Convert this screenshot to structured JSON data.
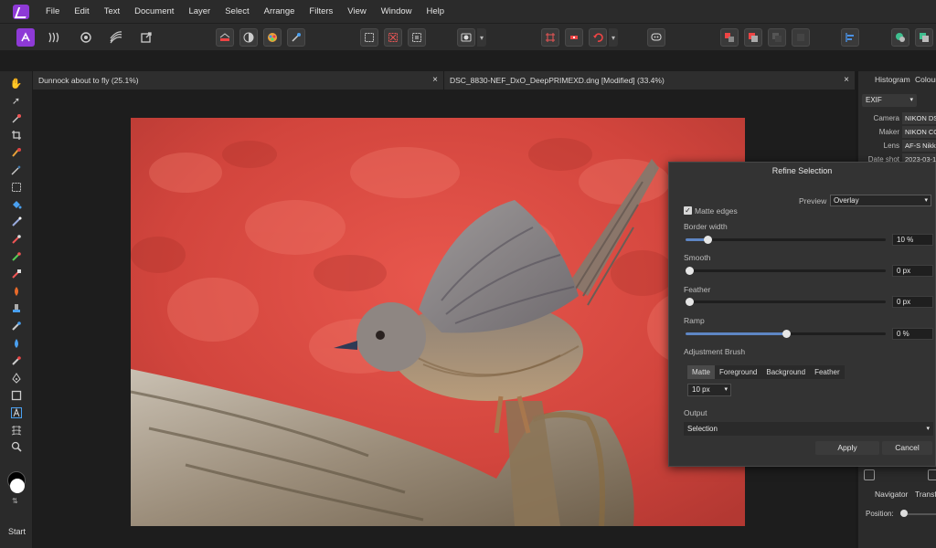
{
  "menu": [
    "File",
    "Edit",
    "Text",
    "Document",
    "Layer",
    "Select",
    "Arrange",
    "Filters",
    "View",
    "Window",
    "Help"
  ],
  "tabs": [
    {
      "title": "Dunnock about to fly (25.1%)",
      "close": "×"
    },
    {
      "title": "DSC_8830-NEF_DxO_DeepPRIMEXD.dng [Modified] (33.4%)",
      "close": "×"
    }
  ],
  "right_panel": {
    "tabs": [
      "Histogram",
      "Colour"
    ],
    "exif_select": "EXIF",
    "exif": [
      {
        "label": "Camera",
        "value": "NIKON DS"
      },
      {
        "label": "Maker",
        "value": "NIKON CO"
      },
      {
        "label": "Lens",
        "value": "AF-S Nikk"
      },
      {
        "label": "Date shot",
        "value": "2023-03-1"
      }
    ],
    "navigator_tabs": [
      "Navigator",
      "Transfo"
    ],
    "position_label": "Position:"
  },
  "tools_footer": {
    "start": "Start"
  },
  "dialog": {
    "title": "Refine Selection",
    "preview_label": "Preview",
    "preview_value": "Overlay",
    "matte_edges": {
      "label": "Matte edges",
      "checked": true,
      "check": "✓"
    },
    "sliders": [
      {
        "label": "Border width",
        "display": "10 %",
        "fraction": 0.11
      },
      {
        "label": "Smooth",
        "display": "0 px",
        "fraction": 0.0
      },
      {
        "label": "Feather",
        "display": "0 px",
        "fraction": 0.0
      },
      {
        "label": "Ramp",
        "display": "0 %",
        "fraction": 0.5
      }
    ],
    "adjustment_brush_label": "Adjustment Brush",
    "brush_modes": [
      "Matte",
      "Foreground",
      "Background",
      "Feather"
    ],
    "brush_active": "Matte",
    "brush_size": "10 px",
    "output_label": "Output",
    "output_value": "Selection",
    "apply": "Apply",
    "cancel": "Cancel"
  },
  "colors": {
    "accent": "#8e3ad6",
    "slider_fill": "#5e86c4",
    "overlay_red": "#d94a41"
  }
}
